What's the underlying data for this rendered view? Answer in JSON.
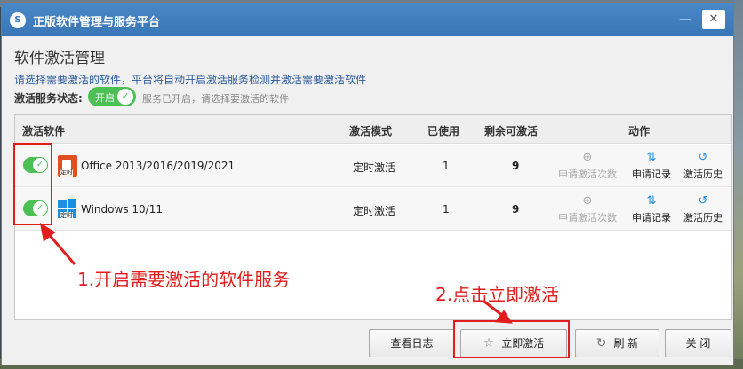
{
  "window": {
    "title": "正版软件管理与服务平台"
  },
  "icons": {
    "app": "app-logo-icon",
    "minimize": "minimize-icon",
    "close": "close-icon"
  },
  "page": {
    "title": "软件激活管理",
    "description": "请选择需要激活的软件，平台将自动开启激活服务检测并激活需要激活软件"
  },
  "service_status": {
    "label": "激活服务状态:",
    "toggle_label": "开启",
    "note": "服务已开启，请选择要激活的软件"
  },
  "table": {
    "headers": {
      "name": "激活软件",
      "mode": "激活模式",
      "used": "已使用",
      "remaining": "剩余可激活",
      "action": "动作"
    },
    "rows": [
      {
        "name": "Office 2013/2016/2019/2021",
        "icon": "office-icon",
        "tag": "定时",
        "mode": "定时激活",
        "used": "1",
        "remaining": "9",
        "enabled": true
      },
      {
        "name": "Windows 10/11",
        "icon": "windows-icon",
        "tag": "定时",
        "mode": "定时激活",
        "used": "1",
        "remaining": "9",
        "enabled": true
      }
    ],
    "actions": {
      "apply": "申请激活次数",
      "record": "申请记录",
      "history": "激活历史"
    }
  },
  "annotations": {
    "step1": "1.开启需要激活的软件服务",
    "step2": "2.点击立即激活",
    "color": "#e01e1e"
  },
  "buttons": {
    "view_log": "查看日志",
    "activate_now": "立即激活",
    "refresh": "刷 新",
    "close": "关 闭"
  },
  "colors": {
    "titlebar": "#3a76b6",
    "toggle_on": "#4cbf55",
    "accent_blue": "#1d8fe1",
    "annotation": "#e01e1e"
  }
}
